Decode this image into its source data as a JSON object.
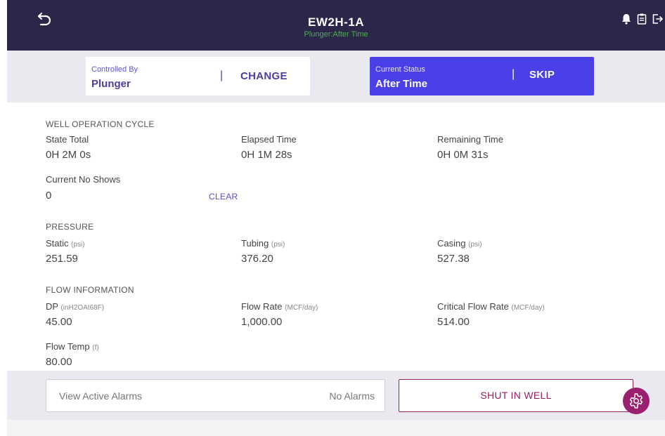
{
  "header": {
    "title": "EW2H-1A",
    "subtitle": "Plunger:After Time"
  },
  "control": {
    "label": "Controlled By",
    "value": "Plunger",
    "separator": "|",
    "action": "CHANGE"
  },
  "status": {
    "label": "Current Status",
    "value": "After Time",
    "separator": "|",
    "action": "SKIP"
  },
  "cycle": {
    "section_title": "WELL OPERATION CYCLE",
    "state_total": {
      "label": "State Total",
      "value": "0H 2M 0s"
    },
    "elapsed_time": {
      "label": "Elapsed Time",
      "value": "0H 1M 28s"
    },
    "remaining_time": {
      "label": "Remaining Time",
      "value": "0H 0M 31s"
    },
    "no_shows": {
      "label": "Current No Shows",
      "value": "0"
    },
    "clear_label": "CLEAR"
  },
  "pressure": {
    "section_title": "PRESSURE",
    "static": {
      "label": "Static",
      "unit": "(psi)",
      "value": "251.59"
    },
    "tubing": {
      "label": "Tubing",
      "unit": "(psi)",
      "value": "376.20"
    },
    "casing": {
      "label": "Casing",
      "unit": "(psi)",
      "value": "527.38"
    }
  },
  "flow": {
    "section_title": "FLOW INFORMATION",
    "dp": {
      "label": "DP",
      "unit": "(inH2OAt68F)",
      "value": "45.00"
    },
    "flow_rate": {
      "label": "Flow Rate",
      "unit": "(MCF/day)",
      "value": "1,000.00"
    },
    "critical_flow_rate": {
      "label": "Critical Flow Rate",
      "unit": "(MCF/day)",
      "value": "514.00"
    },
    "flow_temp": {
      "label": "Flow Temp",
      "unit": "(f)",
      "value": "80.00"
    }
  },
  "bottom": {
    "alarms_label": "View Active Alarms",
    "alarms_count": "No Alarms",
    "shut_in_label": "SHUT IN WELL"
  },
  "colors": {
    "header_bg": "#2b2749",
    "accent": "#4a40e8",
    "subtitle_green": "#4caf50",
    "danger": "#8e2060"
  },
  "icons": [
    "back-icon",
    "bell-icon",
    "clipboard-icon",
    "logout-icon",
    "gear-icon"
  ]
}
